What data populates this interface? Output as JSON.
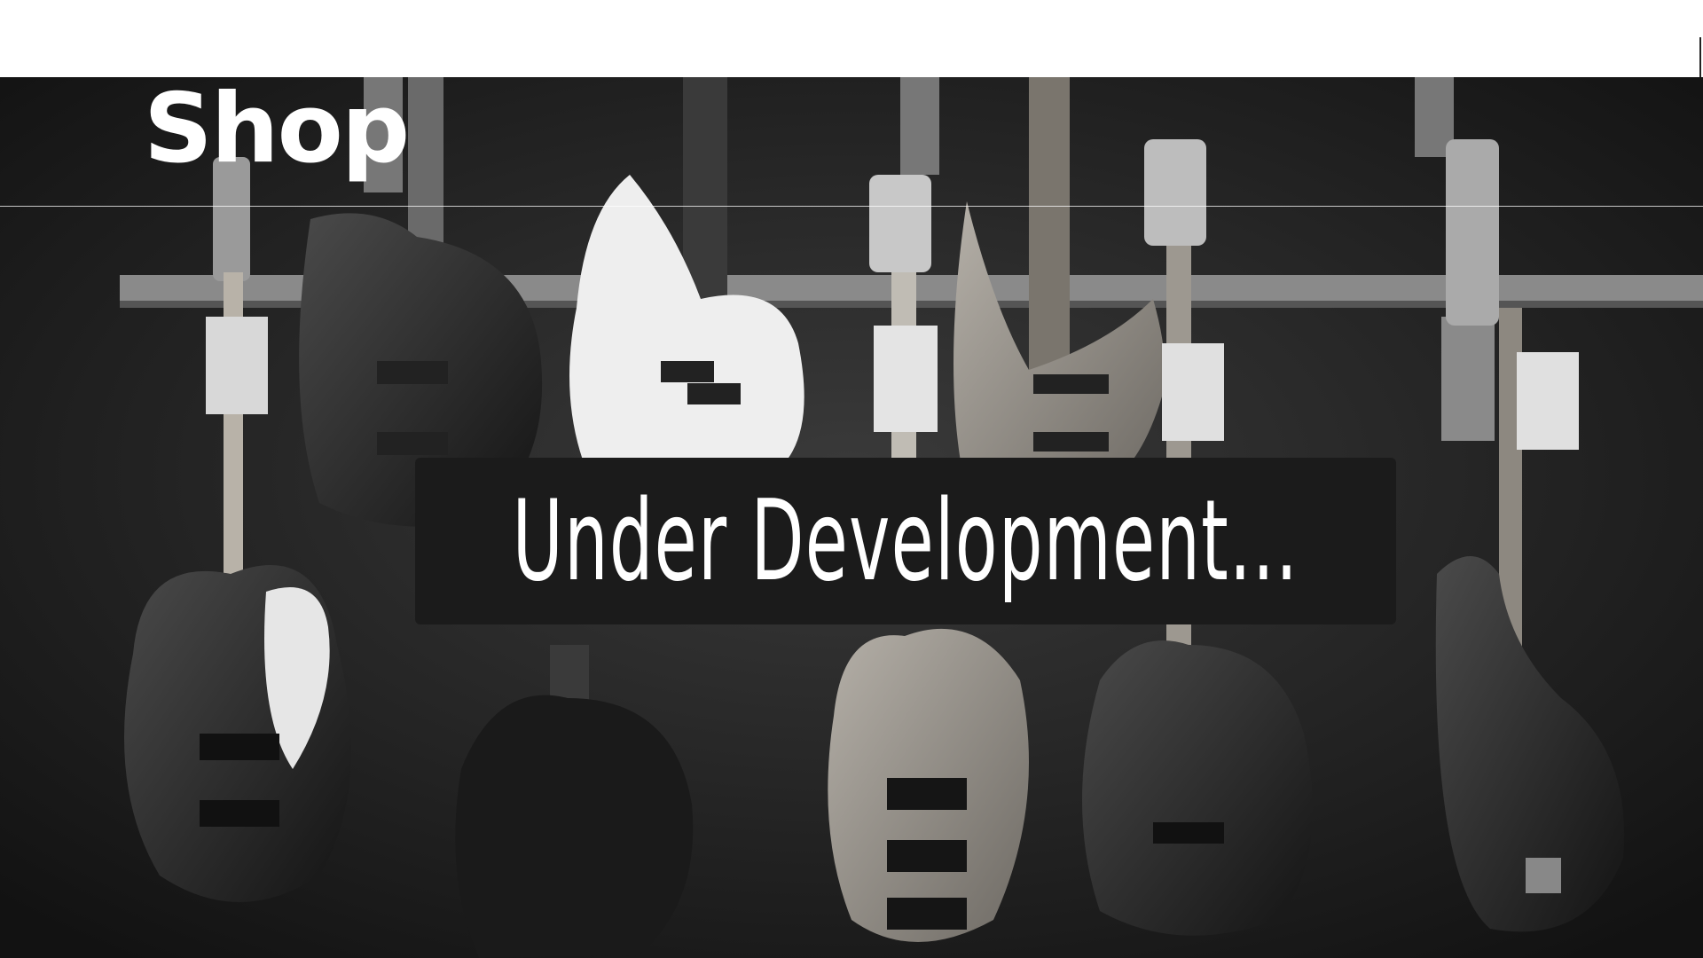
{
  "page": {
    "title": "Shop",
    "status_message": "Under Development..."
  },
  "background": {
    "subject": "bass-guitars-on-wall-rack",
    "tone": "grayscale"
  },
  "colors": {
    "header_bg": "#ffffff",
    "hero_bg": "#1f1f1f",
    "banner_bg": "#1b1b1b",
    "text": "#ffffff"
  }
}
